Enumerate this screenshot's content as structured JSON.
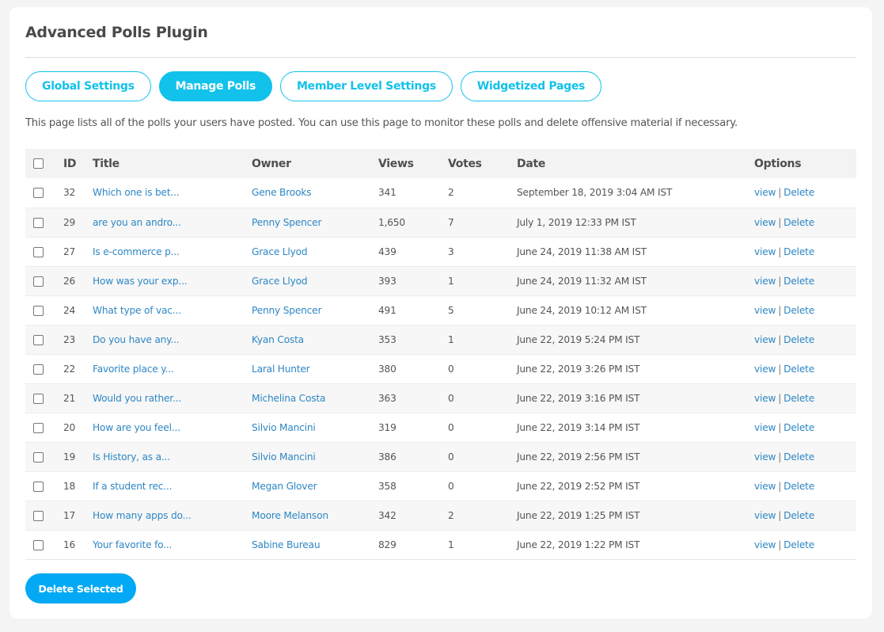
{
  "page": {
    "title": "Advanced Polls Plugin",
    "description": "This page lists all of the polls your users have posted. You can use this page to monitor these polls and delete offensive material if necessary."
  },
  "tabs": [
    {
      "label": "Global Settings",
      "active": false
    },
    {
      "label": "Manage Polls",
      "active": true
    },
    {
      "label": "Member Level Settings",
      "active": false
    },
    {
      "label": "Widgetized Pages",
      "active": false
    }
  ],
  "table": {
    "headers": {
      "id": "ID",
      "title": "Title",
      "owner": "Owner",
      "views": "Views",
      "votes": "Votes",
      "date": "Date",
      "options": "Options"
    },
    "option_labels": {
      "view": "view",
      "separator": "|",
      "delete": "Delete"
    },
    "rows": [
      {
        "id": "32",
        "title": "Which one is bet...",
        "owner": "Gene Brooks",
        "views": "341",
        "votes": "2",
        "date": "September 18, 2019 3:04 AM IST"
      },
      {
        "id": "29",
        "title": "are you an andro...",
        "owner": "Penny Spencer",
        "views": "1,650",
        "votes": "7",
        "date": "July 1, 2019 12:33 PM IST"
      },
      {
        "id": "27",
        "title": "Is e-commerce p...",
        "owner": "Grace Llyod",
        "views": "439",
        "votes": "3",
        "date": "June 24, 2019 11:38 AM IST"
      },
      {
        "id": "26",
        "title": "How was your exp...",
        "owner": "Grace Llyod",
        "views": "393",
        "votes": "1",
        "date": "June 24, 2019 11:32 AM IST"
      },
      {
        "id": "24",
        "title": "What type of vac...",
        "owner": "Penny Spencer",
        "views": "491",
        "votes": "5",
        "date": "June 24, 2019 10:12 AM IST"
      },
      {
        "id": "23",
        "title": "Do you have any...",
        "owner": "Kyan Costa",
        "views": "353",
        "votes": "1",
        "date": "June 22, 2019 5:24 PM IST"
      },
      {
        "id": "22",
        "title": "Favorite place y...",
        "owner": "Laral Hunter",
        "views": "380",
        "votes": "0",
        "date": "June 22, 2019 3:26 PM IST"
      },
      {
        "id": "21",
        "title": "Would you rather...",
        "owner": "Michelina Costa",
        "views": "363",
        "votes": "0",
        "date": "June 22, 2019 3:16 PM IST"
      },
      {
        "id": "20",
        "title": "How are you feel...",
        "owner": "Silvio Mancini",
        "views": "319",
        "votes": "0",
        "date": "June 22, 2019 3:14 PM IST"
      },
      {
        "id": "19",
        "title": "Is History, as a...",
        "owner": "Silvio Mancini",
        "views": "386",
        "votes": "0",
        "date": "June 22, 2019 2:56 PM IST"
      },
      {
        "id": "18",
        "title": "If a student rec...",
        "owner": "Megan Glover",
        "views": "358",
        "votes": "0",
        "date": "June 22, 2019 2:52 PM IST"
      },
      {
        "id": "17",
        "title": "How many apps do...",
        "owner": "Moore Melanson",
        "views": "342",
        "votes": "2",
        "date": "June 22, 2019 1:25 PM IST"
      },
      {
        "id": "16",
        "title": "Your favorite fo...",
        "owner": "Sabine Bureau",
        "views": "829",
        "votes": "1",
        "date": "June 22, 2019 1:22 PM IST"
      }
    ]
  },
  "actions": {
    "delete_selected_label": "Delete Selected"
  },
  "colors": {
    "accent": "#12c2ea",
    "primary_button": "#03a9f4",
    "link": "#2e87c4"
  }
}
